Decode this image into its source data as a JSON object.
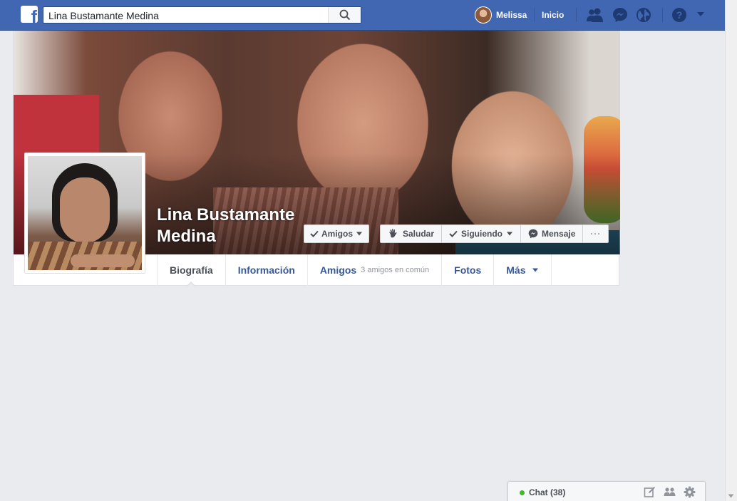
{
  "topbar": {
    "search_value": "Lina Bustamante Medina",
    "user_name": "Melissa",
    "home_label": "Inicio",
    "brand_color": "#4267b2",
    "icons": [
      "friend-requests-icon",
      "messenger-icon",
      "notifications-globe-icon",
      "help-icon",
      "account-menu-caret-icon"
    ]
  },
  "profile": {
    "name": "Lina Bustamante Medina",
    "buttons": {
      "friends": "Amigos",
      "wave": "Saludar",
      "following": "Siguiendo",
      "message": "Mensaje",
      "more": "···"
    }
  },
  "tabs": [
    {
      "label": "Biografía",
      "active": true
    },
    {
      "label": "Información",
      "active": false
    },
    {
      "label": "Amigos",
      "sub": "3 amigos en común",
      "active": false
    },
    {
      "label": "Fotos",
      "active": false
    },
    {
      "label": "Más",
      "active": false
    }
  ],
  "chat": {
    "label": "Chat (38)",
    "status_color": "#42b72a"
  }
}
